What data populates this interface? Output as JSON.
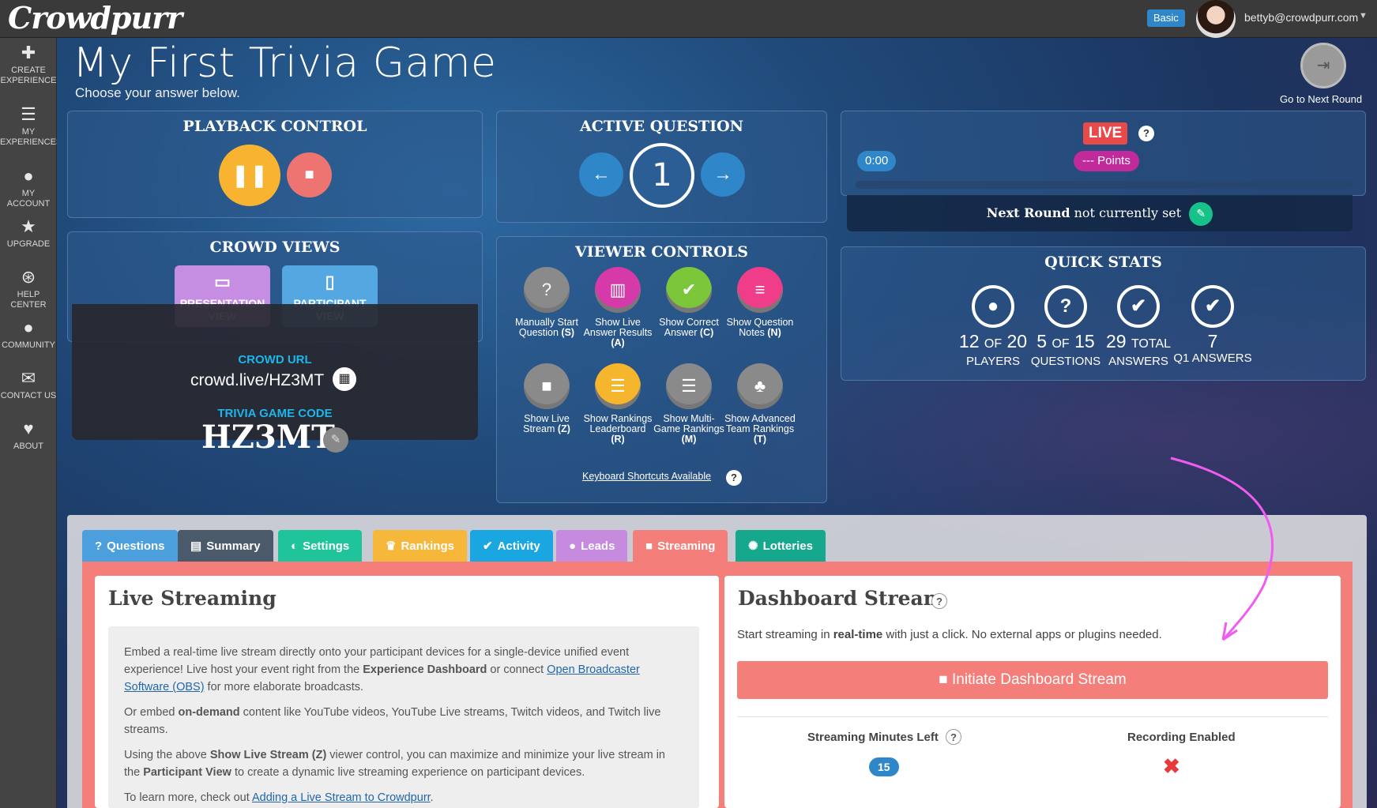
{
  "app": {
    "logo": "Crowdpurr",
    "plan": "Basic",
    "user_email": "bettyb@crowdpurr.com",
    "accent_color": "#2f86c9"
  },
  "sidebar": {
    "items": [
      {
        "icon": "plus-icon",
        "label": "CREATE EXPERIENCE"
      },
      {
        "icon": "list-icon",
        "label": "MY EXPERIENCES"
      },
      {
        "icon": "user-icon",
        "label": "MY ACCOUNT"
      },
      {
        "icon": "star-icon",
        "label": "UPGRADE"
      },
      {
        "icon": "lifebuoy-icon",
        "label": "HELP CENTER"
      },
      {
        "icon": "chat-icon",
        "label": "COMMUNITY"
      },
      {
        "icon": "envelope-icon",
        "label": "CONTACT US"
      },
      {
        "icon": "heart-icon",
        "label": "ABOUT"
      }
    ]
  },
  "header": {
    "title": "My First Trivia Game",
    "subtitle": "Choose your answer below.",
    "next_round_label": "Go to Next Round"
  },
  "playback": {
    "title": "PLAYBACK CONTROL"
  },
  "crowd_views": {
    "title": "CROWD VIEWS",
    "presentation": "PRESENTATION VIEW",
    "participant": "PARTICIPANT VIEW"
  },
  "crowd_url": {
    "url_label": "CROWD URL",
    "url": "crowd.live/HZ3MT",
    "code_label": "TRIVIA GAME CODE",
    "code": "HZ3MT"
  },
  "active_question": {
    "title": "ACTIVE QUESTION",
    "number": "1"
  },
  "viewer_controls": {
    "title": "VIEWER CONTROLS",
    "row1": [
      {
        "label": "Manually Start Question",
        "key": "(S)",
        "color": "#8a8a8a",
        "icon": "question-icon"
      },
      {
        "label": "Show Live Answer Results",
        "key": "(A)",
        "color": "#d63aa8",
        "icon": "bar-chart-icon"
      },
      {
        "label": "Show Correct Answer",
        "key": "(C)",
        "color": "#7cc63a",
        "icon": "check-icon"
      },
      {
        "label": "Show Question Notes",
        "key": "(N)",
        "color": "#ef3d8a",
        "icon": "notes-icon"
      }
    ],
    "row2": [
      {
        "label": "Show Live Stream",
        "key": "(Z)",
        "color": "#8a8a8a",
        "icon": "video-icon"
      },
      {
        "label": "Show Rankings Leaderboard",
        "key": "(R)",
        "color": "#f5b52c",
        "icon": "ranked-list-icon"
      },
      {
        "label": "Show Multi-Game Rankings",
        "key": "(M)",
        "color": "#8a8a8a",
        "icon": "list-icon"
      },
      {
        "label": "Show Advanced Team Rankings",
        "key": "(T)",
        "color": "#8a8a8a",
        "icon": "team-icon"
      }
    ],
    "keyboard_link": "Keyboard Shortcuts Available"
  },
  "live": {
    "badge": "LIVE",
    "timer": "0:00",
    "points": "--- Points",
    "next_round_bold": "Next Round",
    "next_round_rest": " not currently set"
  },
  "quick_stats": {
    "title": "QUICK STATS",
    "stats": [
      {
        "value": "12",
        "of": "OF",
        "total": "20",
        "label": "PLAYERS",
        "icon": "user-icon"
      },
      {
        "value": "5",
        "of": "OF",
        "total": "15",
        "label": "QUESTIONS",
        "icon": "question-icon"
      },
      {
        "value": "29",
        "of": "TOTAL",
        "total": "",
        "label": "ANSWERS",
        "icon": "check-icon"
      },
      {
        "value": "7",
        "of": "",
        "total": "",
        "label": "Q1 ANSWERS",
        "icon": "check-circle-icon"
      }
    ]
  },
  "tabs": [
    {
      "label": "Questions",
      "color": "#4a9fdc",
      "icon": "question-icon"
    },
    {
      "label": "Summary",
      "color": "#4a5a6a",
      "icon": "summary-icon"
    },
    {
      "label": "Settings",
      "color": "#1fc49a",
      "icon": "toggle-icon"
    },
    {
      "label": "Rankings",
      "color": "#f5b83a",
      "icon": "trophy-icon"
    },
    {
      "label": "Activity",
      "color": "#1aa6e0",
      "icon": "check-circle-icon"
    },
    {
      "label": "Leads",
      "color": "#c68adf",
      "icon": "user-icon"
    },
    {
      "label": "Streaming",
      "color": "#f47e7a",
      "icon": "video-icon"
    },
    {
      "label": "Lotteries",
      "color": "#16a88c",
      "icon": "badge-icon"
    }
  ],
  "live_streaming": {
    "title": "Live Streaming",
    "p1_a": "Embed a real-time live stream directly onto your participant devices for a single-device unified event experience! Live host your event right from the ",
    "p1_b": "Experience Dashboard",
    "p1_c": " or connect ",
    "p1_link": "Open Broadcaster Software (OBS)",
    "p1_d": " for more elaborate broadcasts.",
    "p2_a": "Or embed ",
    "p2_b": "on-demand",
    "p2_c": " content like YouTube videos, YouTube Live streams, Twitch videos, and Twitch live streams.",
    "p3_a": "Using the above ",
    "p3_b": "Show Live Stream (Z)",
    "p3_c": " viewer control, you can maximize and minimize your live stream in the ",
    "p3_d": "Participant View",
    "p3_e": " to create a dynamic live streaming experience on participant devices.",
    "p4_a": "To learn more, check out ",
    "p4_link": "Adding a Live Stream to Crowdpurr",
    "p4_b": "."
  },
  "dashboard_stream": {
    "title": "Dashboard Stream",
    "desc_a": "Start streaming in ",
    "desc_b": "real-time",
    "desc_c": " with just a click. No external apps or plugins needed.",
    "button": "Initiate Dashboard Stream",
    "minutes_label": "Streaming Minutes Left",
    "minutes_value": "15",
    "recording_label": "Recording Enabled",
    "recording_status": "✖"
  }
}
